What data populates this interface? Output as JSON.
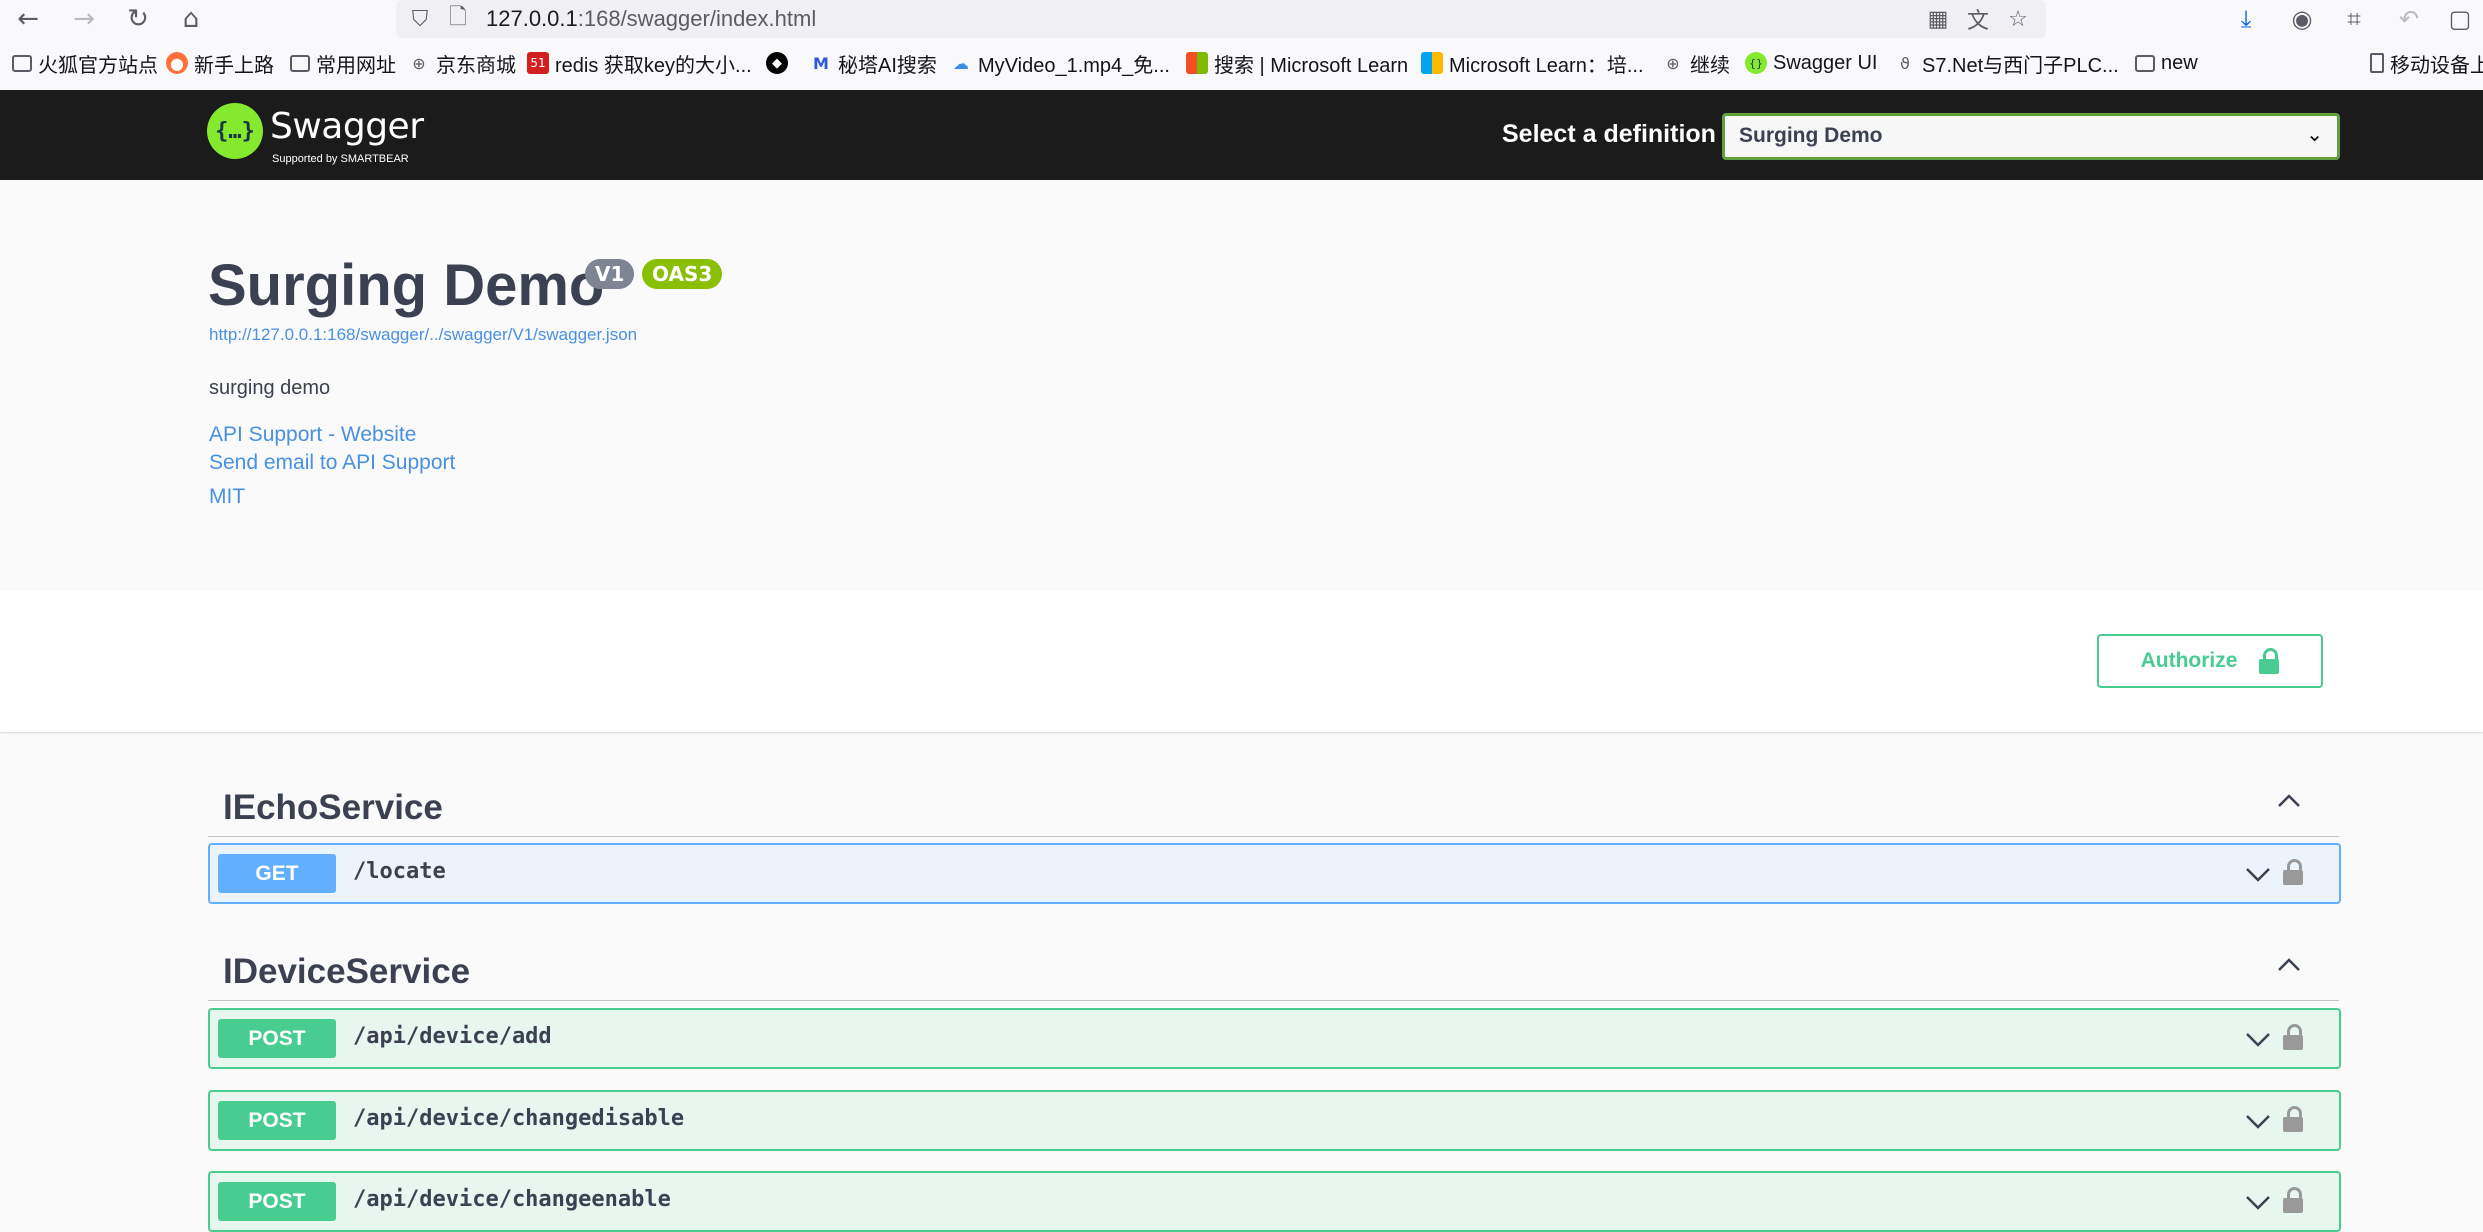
{
  "browser": {
    "url_host": "127.0.0.1",
    "url_rest": ":168/swagger/index.html",
    "bookmarks": [
      {
        "label": "火狐官方站点",
        "icon": "folder-icon"
      },
      {
        "label": "新手上路",
        "icon": "firefox-icon"
      },
      {
        "label": "常用网址",
        "icon": "folder-icon"
      },
      {
        "label": "京东商城",
        "icon": "globe-icon"
      },
      {
        "label": "redis 获取key的大小...",
        "icon": "site-51-icon"
      },
      {
        "label": "",
        "icon": "github-icon"
      },
      {
        "label": "秘塔AI搜索",
        "icon": "metaso-icon"
      },
      {
        "label": "MyVideo_1.mp4_免...",
        "icon": "cloud-icon"
      },
      {
        "label": "搜索 | Microsoft Learn",
        "icon": "microsoft-icon"
      },
      {
        "label": "Microsoft Learn：培...",
        "icon": "microsoft-icon"
      },
      {
        "label": "继续",
        "icon": "globe-icon"
      },
      {
        "label": "Swagger UI",
        "icon": "swagger-icon"
      },
      {
        "label": "S7.Net与西门子PLC...",
        "icon": "s7-icon"
      },
      {
        "label": "new",
        "icon": "folder-icon"
      },
      {
        "label": "移动设备上",
        "icon": "mobile-icon"
      }
    ]
  },
  "topbar": {
    "logo_text": "Swagger",
    "logo_subtext": "Supported by SMARTBEAR",
    "select_label": "Select a definition",
    "selected_definition": "Surging Demo"
  },
  "info": {
    "title": "Surging Demo",
    "version_badge": "V1",
    "oas_badge": "OAS3",
    "spec_url": "http://127.0.0.1:168/swagger/../swagger/V1/swagger.json",
    "description": "surging demo",
    "support_website": "API Support - Website",
    "support_email": "Send email to API Support",
    "license": "MIT"
  },
  "auth": {
    "label": "Authorize"
  },
  "tags": [
    {
      "name": "IEchoService",
      "operations": [
        {
          "method": "GET",
          "path": "/locate"
        }
      ]
    },
    {
      "name": "IDeviceService",
      "operations": [
        {
          "method": "POST",
          "path": "/api/device/add"
        },
        {
          "method": "POST",
          "path": "/api/device/changedisable"
        },
        {
          "method": "POST",
          "path": "/api/device/changeenable"
        }
      ]
    }
  ],
  "colors": {
    "get": "#61affe",
    "post": "#49cc90",
    "topbar": "#1b1b1b",
    "link": "#4990e2"
  }
}
